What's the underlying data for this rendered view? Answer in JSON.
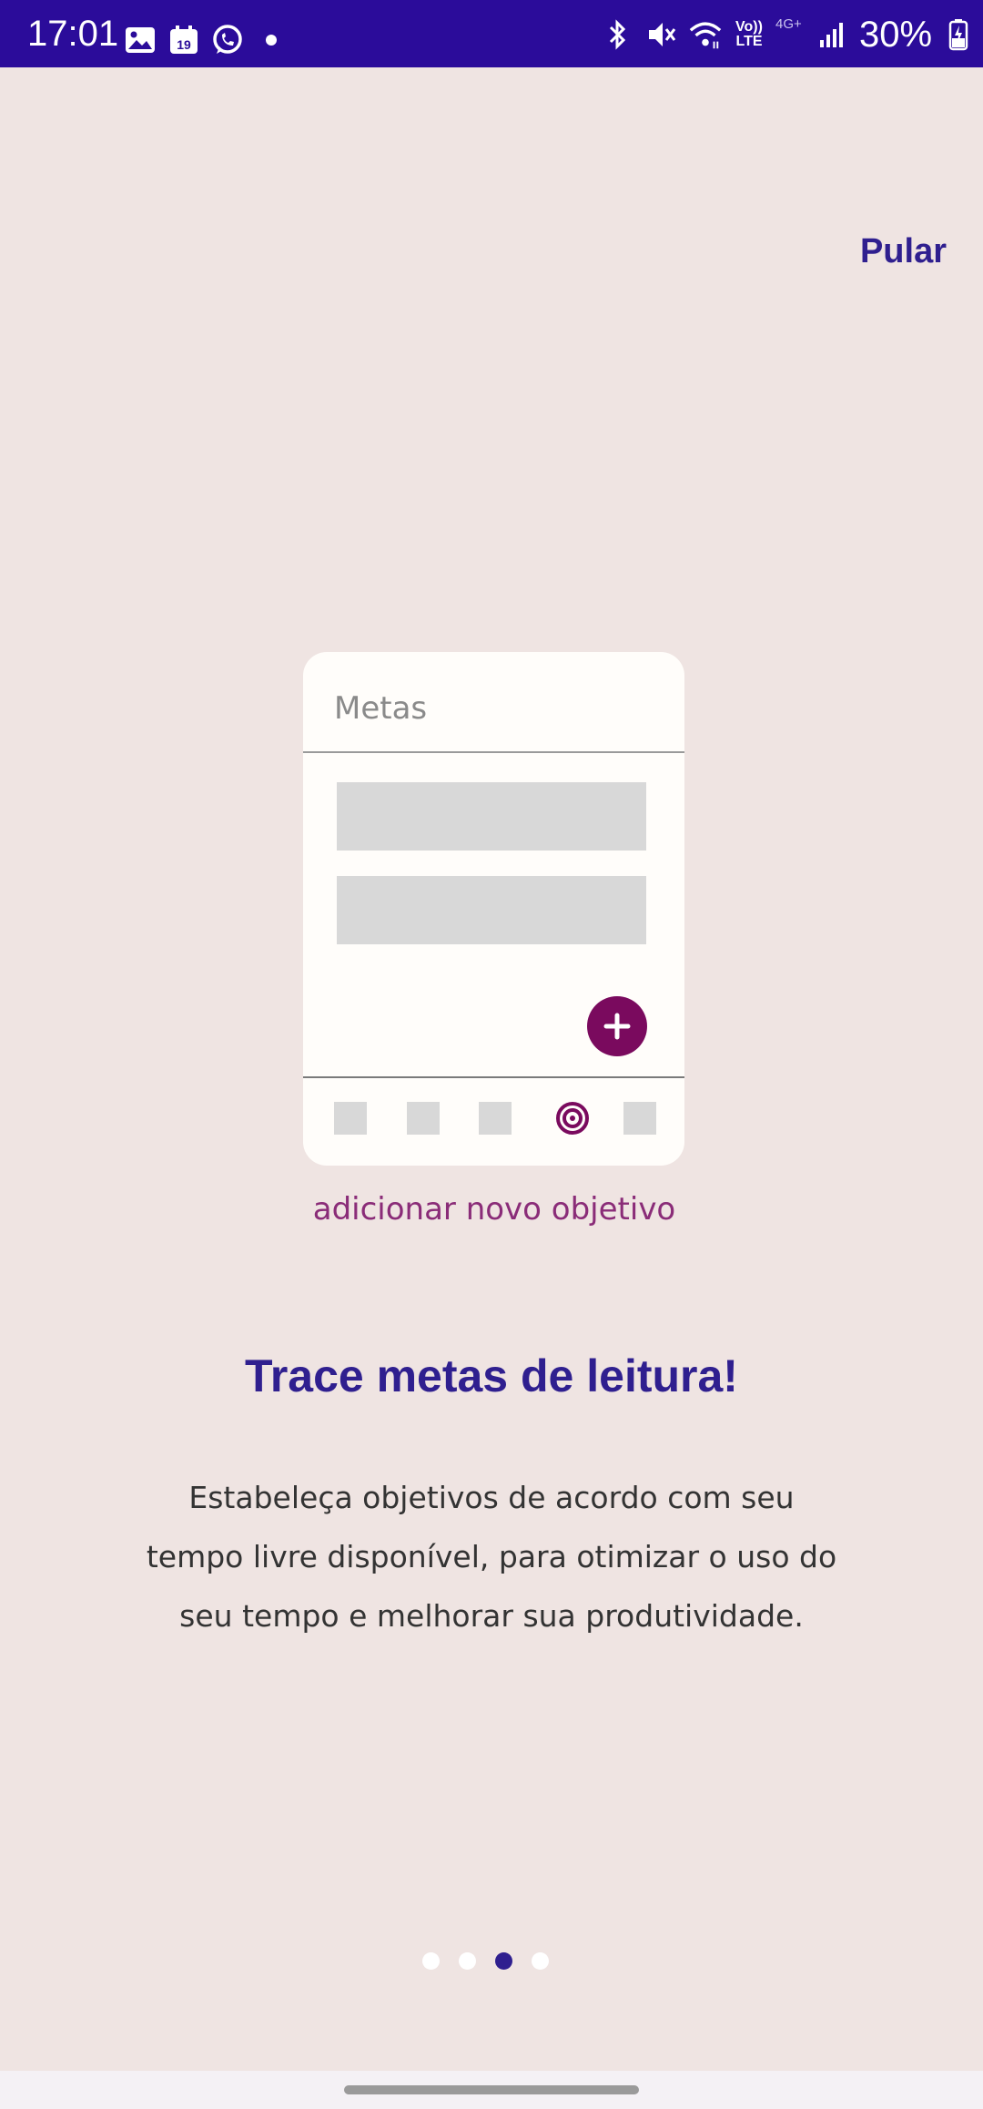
{
  "status_bar": {
    "time": "17:01",
    "calendar_day": "19",
    "network_lte_top": "Vo))",
    "network_lte_bottom": "LTE",
    "network_4g": "4G+",
    "battery": "30%",
    "left_icons": [
      "gallery-icon",
      "calendar-icon",
      "whatsapp-icon",
      "dot-icon"
    ],
    "right_icons": [
      "bluetooth-icon",
      "mute-icon",
      "wifi-icon",
      "volte-icon",
      "signal-icon",
      "battery-icon"
    ]
  },
  "skip_label": "Pular",
  "illustration": {
    "card_title": "Metas",
    "caption": "adicionar novo objetivo",
    "accent_color": "#7a0a5e"
  },
  "headline": "Trace metas de leitura!",
  "description": "Estabeleça objetivos de acordo com seu tempo livre disponível, para otimizar o uso do seu tempo e melhorar sua produtividade.",
  "pager": {
    "total": 4,
    "active_index": 2
  },
  "colors": {
    "status_bar": "#2b0c9a",
    "background": "#efe4e2",
    "brand": "#2f1f8f"
  }
}
